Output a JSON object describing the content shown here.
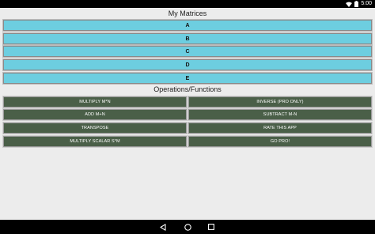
{
  "status_bar": {
    "time": "5:00",
    "wifi_icon": "wifi-icon",
    "battery_icon": "battery-icon"
  },
  "matrices_section": {
    "title": "My Matrices",
    "items": [
      "A",
      "B",
      "C",
      "D",
      "E"
    ]
  },
  "operations_section": {
    "title": "Operations/Functions",
    "buttons": [
      "MULTIPLY M*N",
      "INVERSE (PRO ONLY)",
      "ADD M+N",
      "SUBTRACT M-N",
      "TRANSPOSE",
      "RATE THIS APP",
      "MULTIPLY SCALAR S*M",
      "GO PRO!"
    ]
  },
  "nav_bar": {
    "back_icon": "back-icon",
    "home_icon": "home-icon",
    "recents_icon": "recents-icon"
  },
  "colors": {
    "matrix_button": "#6dcee0",
    "operation_button": "#4a5f48",
    "background": "#ececec"
  }
}
